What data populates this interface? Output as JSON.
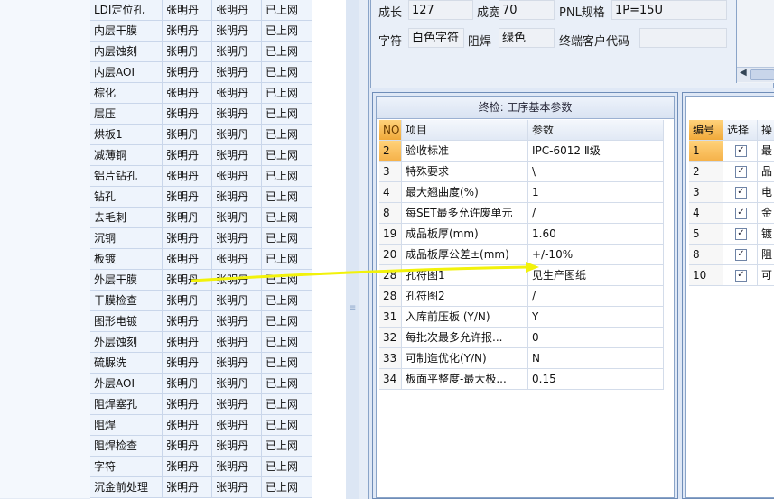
{
  "process_list": {
    "rows": [
      [
        "LDI定位孔",
        "张明丹",
        "张明丹",
        "已上网"
      ],
      [
        "内层干膜",
        "张明丹",
        "张明丹",
        "已上网"
      ],
      [
        "内层蚀刻",
        "张明丹",
        "张明丹",
        "已上网"
      ],
      [
        "内层AOI",
        "张明丹",
        "张明丹",
        "已上网"
      ],
      [
        "棕化",
        "张明丹",
        "张明丹",
        "已上网"
      ],
      [
        "层压",
        "张明丹",
        "张明丹",
        "已上网"
      ],
      [
        "烘板1",
        "张明丹",
        "张明丹",
        "已上网"
      ],
      [
        "减薄铜",
        "张明丹",
        "张明丹",
        "已上网"
      ],
      [
        "铝片钻孔",
        "张明丹",
        "张明丹",
        "已上网"
      ],
      [
        "钻孔",
        "张明丹",
        "张明丹",
        "已上网"
      ],
      [
        "去毛刺",
        "张明丹",
        "张明丹",
        "已上网"
      ],
      [
        "沉铜",
        "张明丹",
        "张明丹",
        "已上网"
      ],
      [
        "板镀",
        "张明丹",
        "张明丹",
        "已上网"
      ],
      [
        "外层干膜",
        "张明丹",
        "张明丹",
        "已上网"
      ],
      [
        "干膜检查",
        "张明丹",
        "张明丹",
        "已上网"
      ],
      [
        "图形电镀",
        "张明丹",
        "张明丹",
        "已上网"
      ],
      [
        "外层蚀刻",
        "张明丹",
        "张明丹",
        "已上网"
      ],
      [
        "硫脲洗",
        "张明丹",
        "张明丹",
        "已上网"
      ],
      [
        "外层AOI",
        "张明丹",
        "张明丹",
        "已上网"
      ],
      [
        "阻焊塞孔",
        "张明丹",
        "张明丹",
        "已上网"
      ],
      [
        "阻焊",
        "张明丹",
        "张明丹",
        "已上网"
      ],
      [
        "阻焊检查",
        "张明丹",
        "张明丹",
        "已上网"
      ],
      [
        "字符",
        "张明丹",
        "张明丹",
        "已上网"
      ],
      [
        "沉金前处理",
        "张明丹",
        "张明丹",
        "已上网"
      ]
    ]
  },
  "info_form": {
    "length_label": "成长",
    "length_value": "127",
    "width_label": "成宽",
    "width_value": "70",
    "pnl_label": "PNL规格",
    "pnl_value": "1P=15U",
    "char_label": "字符",
    "char_value": "白色字符",
    "mask_label": "阻焊",
    "mask_value": "绿色",
    "customer_code_label": "终端客户代码",
    "customer_code_value": ""
  },
  "final_inspection": {
    "title": "终检: 工序基本参数",
    "headers": {
      "no": "NO",
      "item": "项目",
      "param": "参数"
    },
    "rows": [
      {
        "no": "2",
        "item": "验收标准",
        "param": "IPC-6012 Ⅱ级"
      },
      {
        "no": "3",
        "item": "特殊要求",
        "param": "\\"
      },
      {
        "no": "4",
        "item": "最大翘曲度(%)",
        "param": "1"
      },
      {
        "no": "8",
        "item": "每SET最多允许废单元",
        "param": "/"
      },
      {
        "no": "19",
        "item": "成品板厚(mm)",
        "param": "1.60"
      },
      {
        "no": "20",
        "item": "成品板厚公差±(mm)",
        "param": "+/-10%"
      },
      {
        "no": "28",
        "item": "孔符图1",
        "param": "见生产图纸"
      },
      {
        "no": "28",
        "item": "孔符图2",
        "param": "/"
      },
      {
        "no": "31",
        "item": "入库前压板 (Y/N)",
        "param": "Y"
      },
      {
        "no": "32",
        "item": "每批次最多允许报...",
        "param": "0"
      },
      {
        "no": "33",
        "item": "可制造优化(Y/N)",
        "param": "N"
      },
      {
        "no": "34",
        "item": "板面平整度-最大极...",
        "param": "0.15"
      }
    ]
  },
  "right_list": {
    "headers": {
      "num": "编号",
      "select": "选择",
      "extra": "操"
    },
    "rows": [
      {
        "num": "1",
        "text": "最"
      },
      {
        "num": "2",
        "text": "品"
      },
      {
        "num": "3",
        "text": "电"
      },
      {
        "num": "4",
        "text": "金"
      },
      {
        "num": "5",
        "text": "镀"
      },
      {
        "num": "8",
        "text": "阻"
      },
      {
        "num": "10",
        "text": "可"
      }
    ]
  },
  "colors": {
    "accent_header": "#f0a93a",
    "annotation_arrow": "#f2f20a",
    "grid_bg": "#eef4fc"
  }
}
